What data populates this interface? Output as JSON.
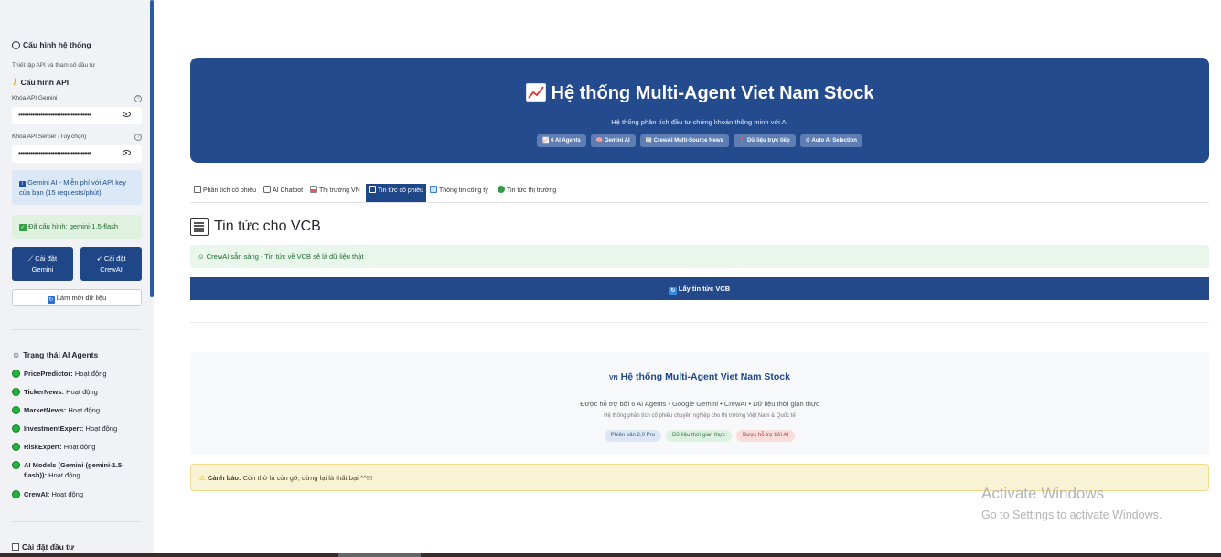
{
  "sidebar": {
    "config_title": "Cấu hình hệ thống",
    "config_subtitle": "Thiết lập API và tham số đầu tư",
    "api_title": "Cấu hình API",
    "gemini_key_label": "Khóa API Gemini",
    "gemini_key_value": "••••••••••••••••••••••••••••••••••••",
    "serper_key_label": "Khóa API Serper (Tùy chọn)",
    "serper_key_value": "••••••••••••••••••••••••••••••••••••",
    "help_glyph": "?",
    "gemini_info": "Gemini AI - Miễn phí với API key của bạn (15 requests/phút)",
    "configured_status": "Đã cấu hình: gemini-1.5-flash",
    "install_gemini_line1": "Cài đặt",
    "install_gemini_line2": "Gemini",
    "install_crewai_line1": "Cài đặt",
    "install_crewai_line2": "CrewAI",
    "refresh_label": "Làm mới dữ liệu",
    "agents_title": "Trạng thái AI Agents",
    "agents": [
      {
        "name": "PricePredictor:",
        "status": "Hoạt động"
      },
      {
        "name": "TickerNews:",
        "status": "Hoạt động"
      },
      {
        "name": "MarketNews:",
        "status": "Hoạt động"
      },
      {
        "name": "InvestmentExpert:",
        "status": "Hoạt động"
      },
      {
        "name": "RiskExpert:",
        "status": "Hoạt động"
      },
      {
        "name": "AI Models (Gemini (gemini-1.5-flash)):",
        "status": "Hoạt động"
      },
      {
        "name": "CrewAI:",
        "status": "Hoạt động"
      }
    ],
    "investment_title": "Cài đặt đầu tư"
  },
  "hero": {
    "title": "Hệ thống Multi-Agent Viet Nam Stock",
    "subtitle": "Hệ thống phân tích đầu tư chứng khoán thông minh với AI",
    "badges": [
      "📈 6 AI Agents",
      "🧠 Gemini AI",
      "📰 CrewAI Multi-Source News",
      "📍 Dữ liệu trực tiếp",
      "⚙ Auto AI Selection"
    ]
  },
  "tabs": [
    {
      "label": "Phân tích cổ phiếu",
      "active": false
    },
    {
      "label": "AI Chatbot",
      "active": false
    },
    {
      "label": "Thị trường VN",
      "active": false
    },
    {
      "label": "Tin tức cổ phiếu",
      "active": true
    },
    {
      "label": "Thông tin công ty",
      "active": false
    },
    {
      "label": "Tin tức thị trường",
      "active": false
    }
  ],
  "main": {
    "news_title": "Tin tức cho VCB",
    "crew_status": "CrewAI sẵn sàng - Tin tức về VCB sẽ là dữ liệu thật",
    "fetch_button": "Lấy tin tức VCB"
  },
  "footer": {
    "title_prefix": "VN",
    "title": "Hệ thống Multi-Agent Viet Nam Stock",
    "line1": "Được hỗ trợ bởi 6 AI Agents • Google Gemini • CrewAI • Dữ liệu thời gian thực",
    "line2": "Hệ thống phân tích cổ phiếu chuyên nghiệp cho thị trường Việt Nam & Quốc tế",
    "pills": [
      {
        "label": "Phiên bản 2.0 Pro",
        "bg": "#dde6f4",
        "fg": "#3a5a8a"
      },
      {
        "label": "Dữ liệu thời gian thực",
        "bg": "#ddf1e2",
        "fg": "#2f7a3e"
      },
      {
        "label": "Được hỗ trợ bởi AI",
        "bg": "#f9dcdc",
        "fg": "#a33a3a"
      }
    ]
  },
  "warning": {
    "label": "Cảnh báo:",
    "text": "Còn thở là còn gỡ, dừng lại là thất bại ^^!!!"
  },
  "watermark": {
    "line1": "Activate Windows",
    "line2": "Go to Settings to activate Windows."
  },
  "colors": {
    "primary": "#1f4788",
    "hero_bg": "#244b8e",
    "success": "#22b33b"
  }
}
